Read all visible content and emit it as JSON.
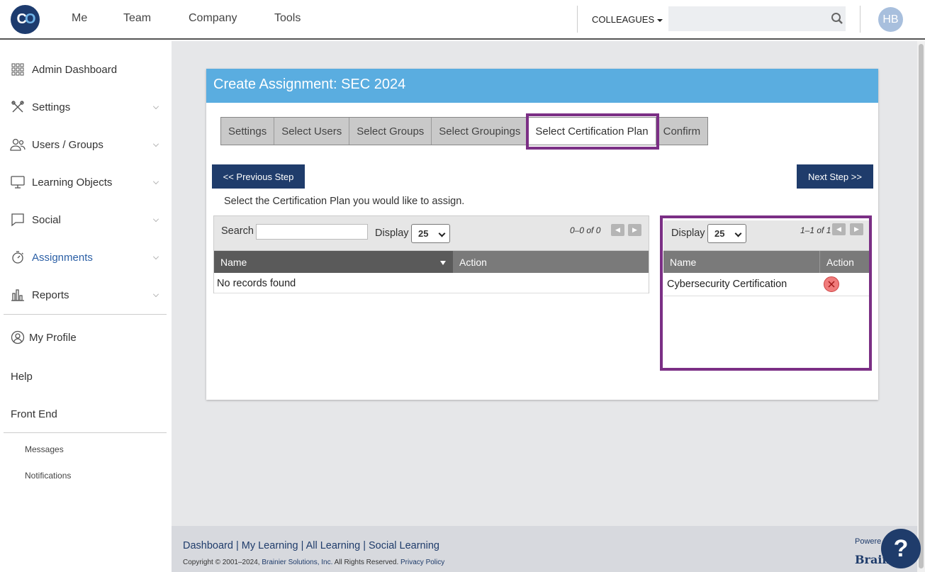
{
  "topnav": {
    "logo_text": "CO",
    "items": [
      "Me",
      "Team",
      "Company",
      "Tools"
    ],
    "colleagues_label": "COLLEAGUES",
    "search_placeholder": "",
    "avatar_initials": "HB"
  },
  "sidebar": {
    "items": [
      {
        "label": "Admin Dashboard",
        "icon": "grid-icon"
      },
      {
        "label": "Settings",
        "icon": "tools-icon"
      },
      {
        "label": "Users / Groups",
        "icon": "users-icon"
      },
      {
        "label": "Learning Objects",
        "icon": "monitor-icon"
      },
      {
        "label": "Social",
        "icon": "chat-icon"
      },
      {
        "label": "Assignments",
        "icon": "stopwatch-icon"
      },
      {
        "label": "Reports",
        "icon": "bar-chart-icon"
      }
    ],
    "my_profile": "My Profile",
    "help": "Help",
    "front_end": "Front End",
    "messages": "Messages",
    "notifications": "Notifications"
  },
  "panel": {
    "title": "Create Assignment: SEC 2024",
    "tabs": [
      "Settings",
      "Select Users",
      "Select Groups",
      "Select Groupings",
      "Select Certification Plan",
      "Confirm"
    ],
    "active_tab": "Select Certification Plan",
    "prev_button": "<< Previous Step",
    "next_button": "Next Step >>",
    "instruction": "Select the Certification Plan you would like to assign."
  },
  "left_grid": {
    "search_label": "Search",
    "search_value": "",
    "display_label": "Display",
    "display_value": "25",
    "pager": "0–0 of 0",
    "col_name": "Name",
    "col_action": "Action",
    "empty_text": "No records found"
  },
  "right_grid": {
    "display_label": "Display",
    "display_value": "25",
    "pager": "1–1 of 1",
    "col_name": "Name",
    "col_action": "Action",
    "rows": [
      {
        "name": "Cybersecurity Certification"
      }
    ]
  },
  "footer": {
    "link_dashboard": "Dashboard",
    "link_my_learning": "My Learning",
    "link_all_learning": "All Learning",
    "link_social_learning": "Social Learning",
    "sep": " | ",
    "copyright": "Copyright © 2001–2024,",
    "company": "Brainier Solutions, Inc.",
    "rights": "All Rights Reserved.",
    "privacy": "Privacy Policy",
    "powered": "Powere",
    "brand": "Brain",
    "help_fab": "?"
  },
  "colors": {
    "header_blue": "#5aade0",
    "navy": "#1f3c6b",
    "highlight_purple": "#7b2f85",
    "remove_red": "#f07b7b"
  }
}
